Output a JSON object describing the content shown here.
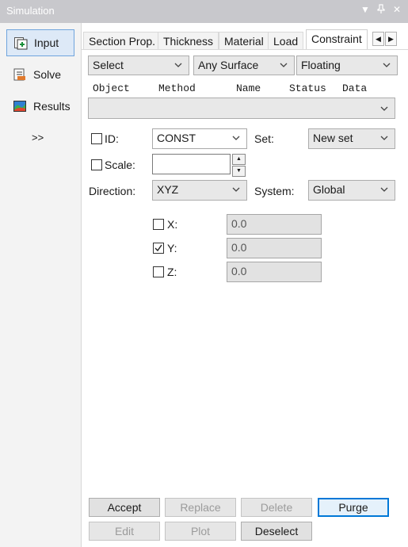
{
  "window": {
    "title": "Simulation"
  },
  "sidebar": {
    "items": [
      {
        "label": "Input",
        "icon": "input-icon",
        "active": true
      },
      {
        "label": "Solve",
        "icon": "solve-icon",
        "active": false
      },
      {
        "label": "Results",
        "icon": "results-icon",
        "active": false
      }
    ],
    "more_label": ">>"
  },
  "tabs": [
    {
      "label": "Section Prop."
    },
    {
      "label": "Thickness"
    },
    {
      "label": "Material"
    },
    {
      "label": "Load"
    },
    {
      "label": "Constraint",
      "active": true
    }
  ],
  "filters": {
    "select": "Select",
    "surface": "Any Surface",
    "mode": "Floating"
  },
  "columns": [
    "Object",
    "Method",
    "Name",
    "Status",
    "Data"
  ],
  "form": {
    "id_label": "ID:",
    "id_value": "CONST",
    "set_label": "Set:",
    "set_value": "New set",
    "scale_label": "Scale:",
    "scale_value": "",
    "direction_label": "Direction:",
    "direction_value": "XYZ",
    "system_label": "System:",
    "system_value": "Global"
  },
  "axes": [
    {
      "label": "X:",
      "checked": false,
      "value": "0.0"
    },
    {
      "label": "Y:",
      "checked": true,
      "value": "0.0"
    },
    {
      "label": "Z:",
      "checked": false,
      "value": "0.0"
    }
  ],
  "buttons": {
    "accept": "Accept",
    "replace": "Replace",
    "delete": "Delete",
    "purge": "Purge",
    "edit": "Edit",
    "plot": "Plot",
    "deselect": "Deselect"
  },
  "colors": {
    "accent": "#0078d7",
    "titlebar": "#c8c8cc"
  }
}
